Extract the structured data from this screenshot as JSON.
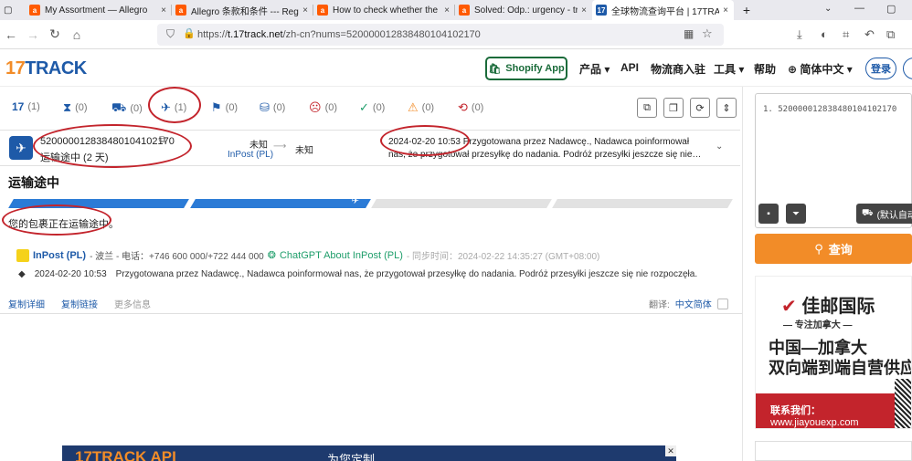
{
  "tabs": [
    {
      "title": "My Assortment — Allegro",
      "fav": "a",
      "color": "#ff5a00",
      "active": false
    },
    {
      "title": "Allegro 条款和条件 --- Regula",
      "fav": "a",
      "color": "#ff5a00",
      "active": false
    },
    {
      "title": "How to check whether the b",
      "fav": "a",
      "color": "#ff5a00",
      "active": false
    },
    {
      "title": "Solved: Odp.: urgency - track",
      "fav": "a",
      "color": "#ff5a00",
      "active": false
    },
    {
      "title": "全球物流查询平台 | 17TRACK",
      "fav": "17",
      "color": "#1e5aa8",
      "active": true
    }
  ],
  "tab_close": "×",
  "new_tab": "+",
  "url": {
    "prefix": "https://",
    "host": "t.17track.net",
    "path": "/zh-cn?nums=520000012838480104102170"
  },
  "header": {
    "logo_17": "17",
    "logo_track": "TRACK",
    "shopify": "Shopify App",
    "menu": [
      "产品 ▾",
      "API",
      "物流商入驻",
      "工具 ▾",
      "帮助",
      "⊕ 简体中文 ▾"
    ],
    "login": "登录"
  },
  "filters": [
    {
      "icon": "17",
      "count": "(1)"
    },
    {
      "icon": "⧗",
      "count": "(0)"
    },
    {
      "icon": "⛟",
      "count": "(0)"
    },
    {
      "icon": "✈",
      "count": "(1)"
    },
    {
      "icon": "⚑",
      "count": "(0)"
    },
    {
      "icon": "⛁",
      "count": "(0)"
    },
    {
      "icon": "☹",
      "count": "(0)"
    },
    {
      "icon": "✓",
      "count": "(0)"
    },
    {
      "icon": "⚠",
      "count": "(0)"
    },
    {
      "icon": "⟲",
      "count": "(0)"
    }
  ],
  "shipment": {
    "number": "520000012838480104102170",
    "status": "运输途中 (2 天)",
    "origin": "未知",
    "carrier": "InPost (PL)",
    "destination": "未知",
    "event_date": "2024-02-20 10:53",
    "event_text": "Przygotowana przez Nadawcę., Nadawca poinformował nas, że przygotował przesyłkę do nadania. Podróż przesyłki jeszcze się nie…"
  },
  "detail": {
    "heading": "运输途中",
    "info": "您的包裹正在运输途中。",
    "carrier_name": "InPost (PL)",
    "carrier_meta": "- 波兰 - 电话：+746 600 000/+722 444 000",
    "chatgpt": "ChatGPT About InPost (PL)",
    "sync": "- 同步时间：2024-02-22 14:35:27 (GMT+08:00)",
    "event_date": "2024-02-20 10:53",
    "event_text": "Przygotowana przez Nadawcę., Nadawca poinformował nas, że przygotował przesyłkę do nadania. Podróż przesyłki jeszcze się nie rozpoczęła.",
    "copy_detail": "复制详细",
    "copy_link": "复制链接",
    "more_info": "更多信息",
    "translate": "翻译:",
    "lang": "中文简体"
  },
  "sidebar": {
    "textarea": "1. 520000012838480104102170",
    "default_btn": "(默认自动",
    "search": "查询"
  },
  "ad": {
    "brand": "佳邮国际",
    "slogan": "— 专注加拿大 —",
    "line1": "中国—加拿大",
    "line2": "双向端到端自营供应",
    "contact": "联系我们：",
    "site": "www.jiayouexp.com"
  },
  "banner": {
    "logo": "17TRACK API",
    "text": "为您定制"
  }
}
